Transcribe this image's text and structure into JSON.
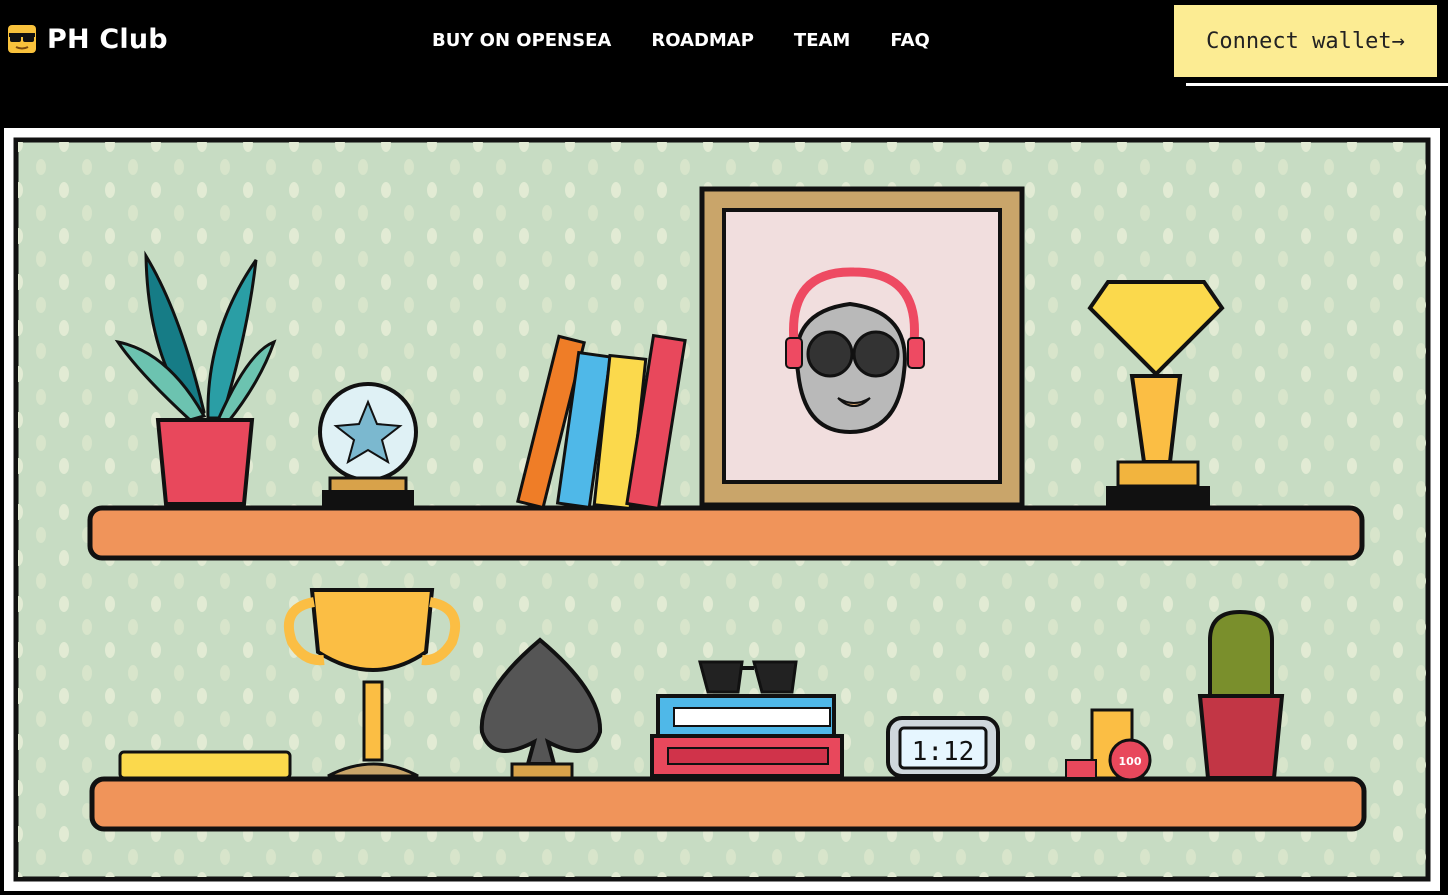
{
  "brand": {
    "name": "PH Club",
    "icon": "sunglasses-emoji-icon"
  },
  "nav": {
    "items": [
      {
        "label": "BUY ON OPENSEA"
      },
      {
        "label": "ROADMAP"
      },
      {
        "label": "TEAM"
      },
      {
        "label": "FAQ"
      }
    ]
  },
  "wallet_button": {
    "label": "Connect wallet→"
  },
  "shelf_scene": {
    "clock_text": "1:12",
    "chip_text": "100"
  },
  "colors": {
    "background": "#000000",
    "button": "#fcec93",
    "wall": "#c7dcc3",
    "shelf": "#f0945a",
    "text": "#ffffff"
  }
}
